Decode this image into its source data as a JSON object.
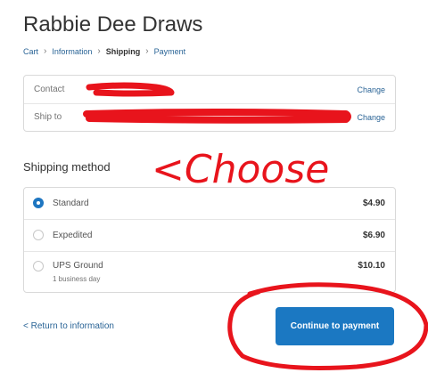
{
  "shop": {
    "title": "Rabbie Dee Draws"
  },
  "breadcrumb": [
    {
      "label": "Cart"
    },
    {
      "label": "Information"
    },
    {
      "label": "Shipping"
    },
    {
      "label": "Payment"
    }
  ],
  "review": {
    "contact": {
      "label": "Contact",
      "value": "",
      "change": "Change"
    },
    "ship_to": {
      "label": "Ship to",
      "value": "",
      "change": "Change"
    }
  },
  "shipping": {
    "heading": "Shipping method",
    "methods": [
      {
        "name": "Standard",
        "sub": "",
        "price": "$4.90",
        "selected": true
      },
      {
        "name": "Expedited",
        "sub": "",
        "price": "$6.90",
        "selected": false
      },
      {
        "name": "UPS Ground",
        "sub": "1 business day",
        "price": "$10.10",
        "selected": false
      }
    ]
  },
  "footer": {
    "return_label": "< Return to information",
    "continue_label": "Continue to payment"
  },
  "annotation": {
    "text": "<Choose",
    "color": "#e8141c"
  },
  "colors": {
    "accent": "#1b78c2",
    "link": "#2a6496",
    "annotation": "#e8141c"
  }
}
